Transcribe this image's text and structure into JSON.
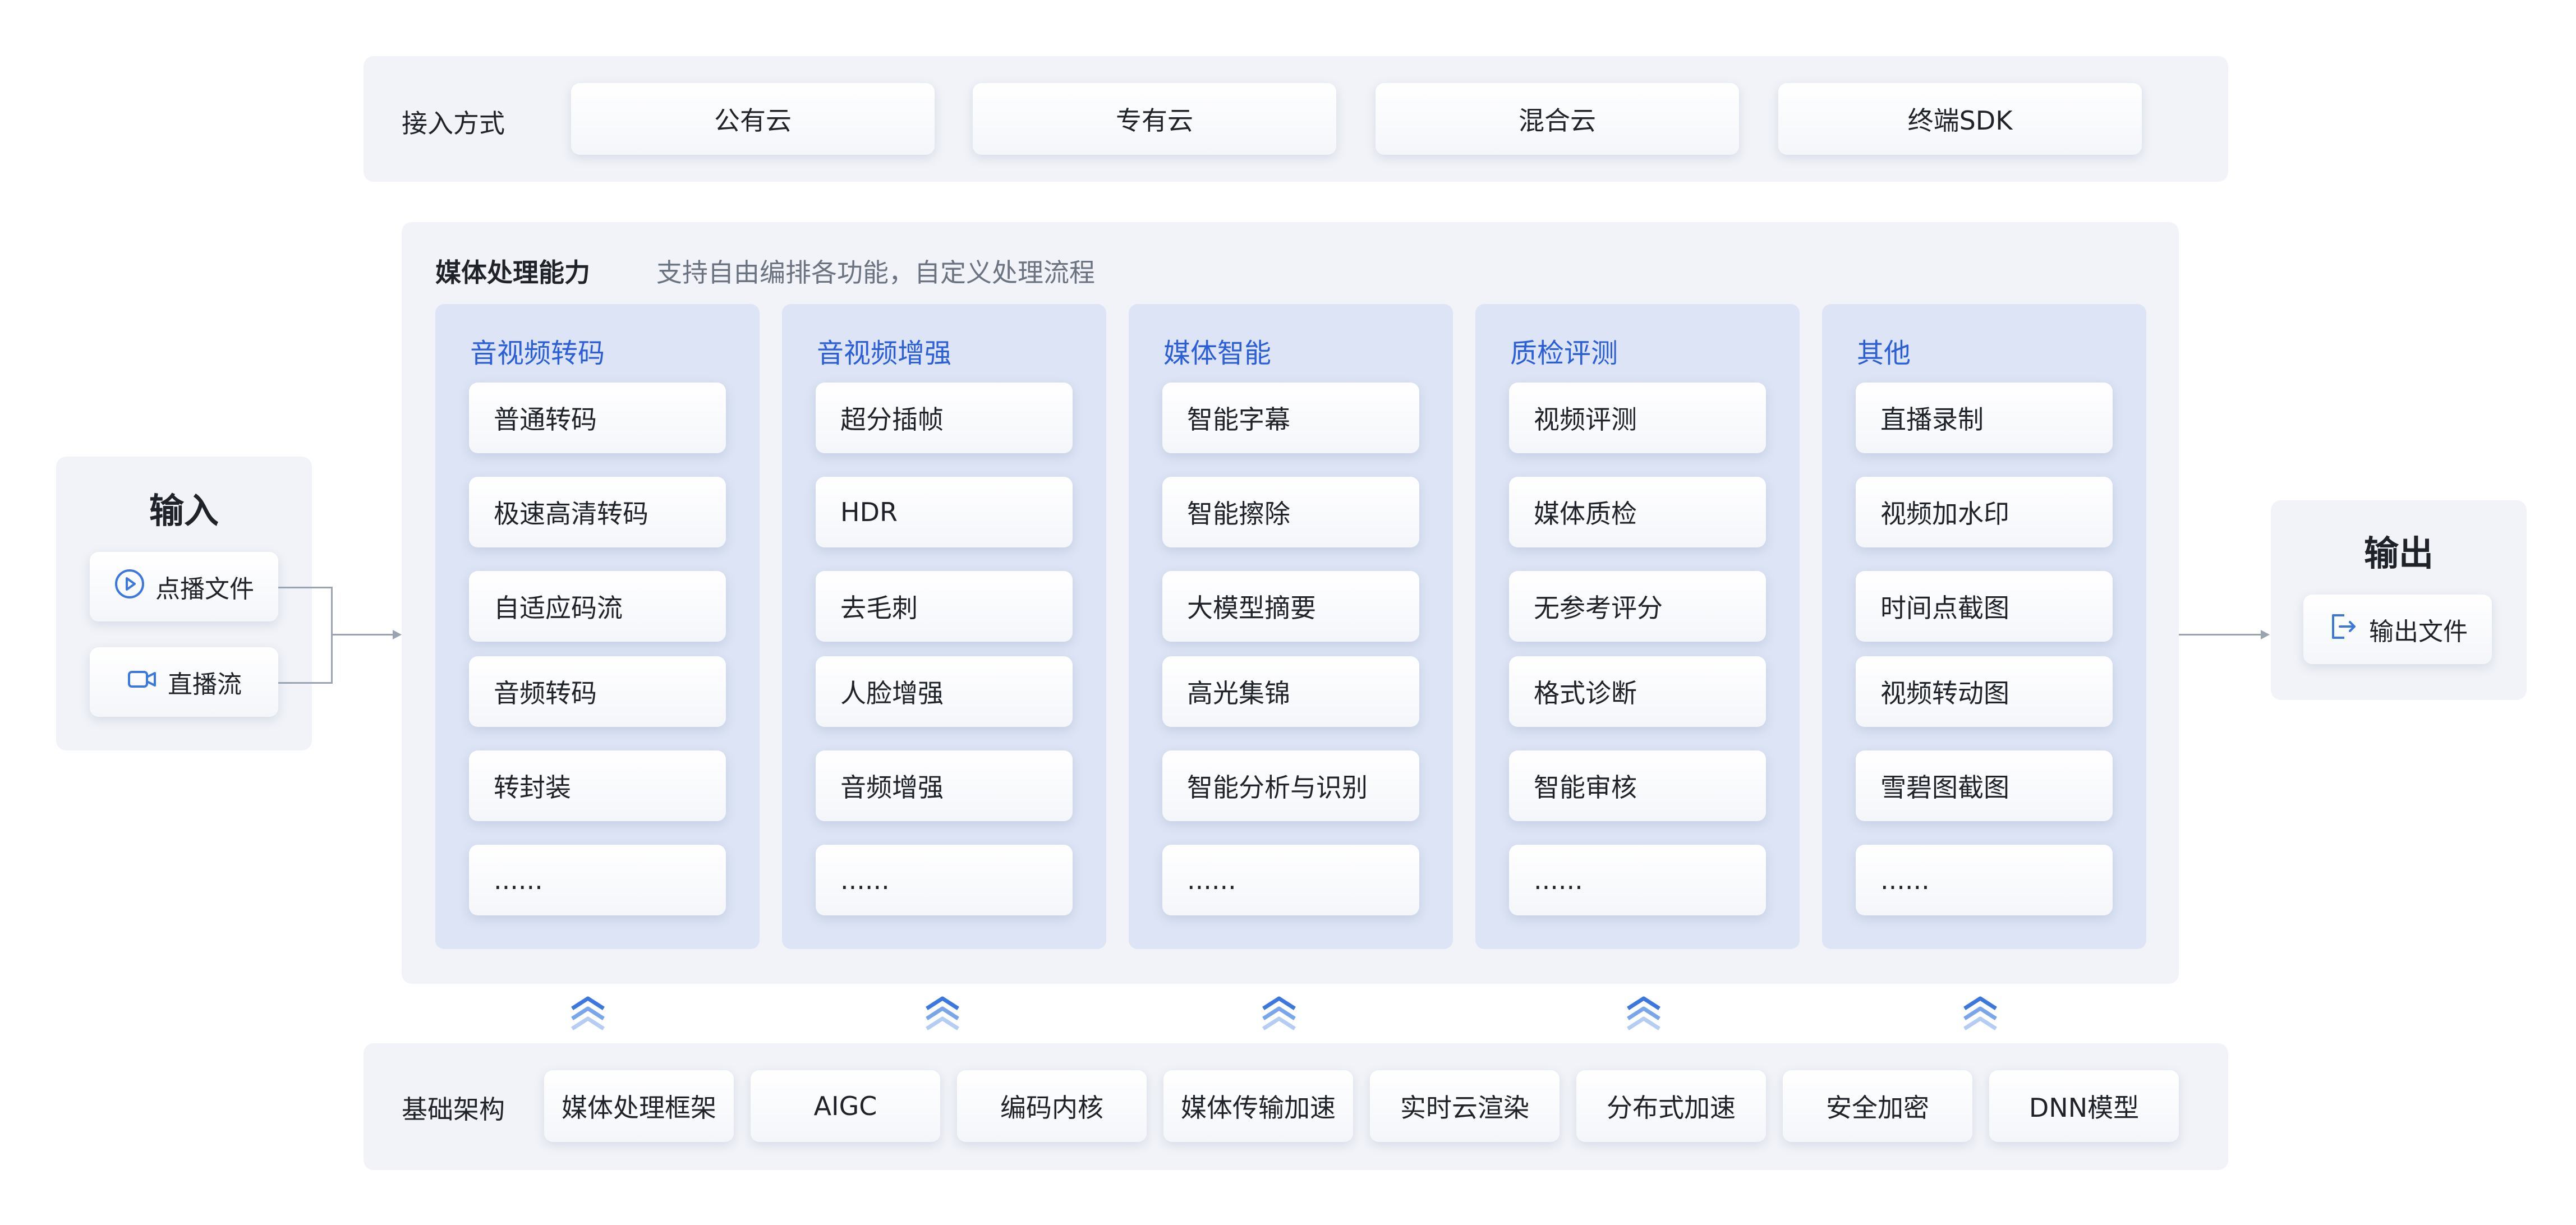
{
  "access": {
    "label": "接入方式",
    "options": [
      "公有云",
      "专有云",
      "混合云",
      "终端SDK"
    ]
  },
  "media": {
    "title": "媒体处理能力",
    "subtitle": "支持自由编排各功能，自定义处理流程",
    "columns": [
      {
        "title": "音视频转码",
        "items": [
          "普通转码",
          "极速高清转码",
          "自适应码流",
          "音频转码",
          "转封装",
          "......"
        ]
      },
      {
        "title": "音视频增强",
        "items": [
          "超分插帧",
          "HDR",
          "去毛刺",
          "人脸增强",
          "音频增强",
          "......"
        ]
      },
      {
        "title": "媒体智能",
        "items": [
          "智能字幕",
          "智能擦除",
          "大模型摘要",
          "高光集锦",
          "智能分析与识别",
          "......"
        ]
      },
      {
        "title": "质检评测",
        "items": [
          "视频评测",
          "媒体质检",
          "无参考评分",
          "格式诊断",
          "智能审核",
          "......"
        ]
      },
      {
        "title": "其他",
        "items": [
          "直播录制",
          "视频加水印",
          "时间点截图",
          "视频转动图",
          "雪碧图截图",
          "......"
        ]
      }
    ]
  },
  "input": {
    "title": "输入",
    "items": [
      {
        "label": "点播文件",
        "icon": "play-circle-icon"
      },
      {
        "label": "直播流",
        "icon": "video-camera-icon"
      }
    ]
  },
  "output": {
    "title": "输出",
    "items": [
      {
        "label": "输出文件",
        "icon": "file-export-icon"
      }
    ]
  },
  "infra": {
    "label": "基础架构",
    "items": [
      "媒体处理框架",
      "AIGC",
      "编码内核",
      "媒体传输加速",
      "实时云渲染",
      "分布式加速",
      "安全加密",
      "DNN模型"
    ]
  },
  "colors": {
    "accent": "#2b5fd9",
    "panel": "#f1f3f8",
    "column": "#dce4f5",
    "chevron": "#3a78e0"
  }
}
